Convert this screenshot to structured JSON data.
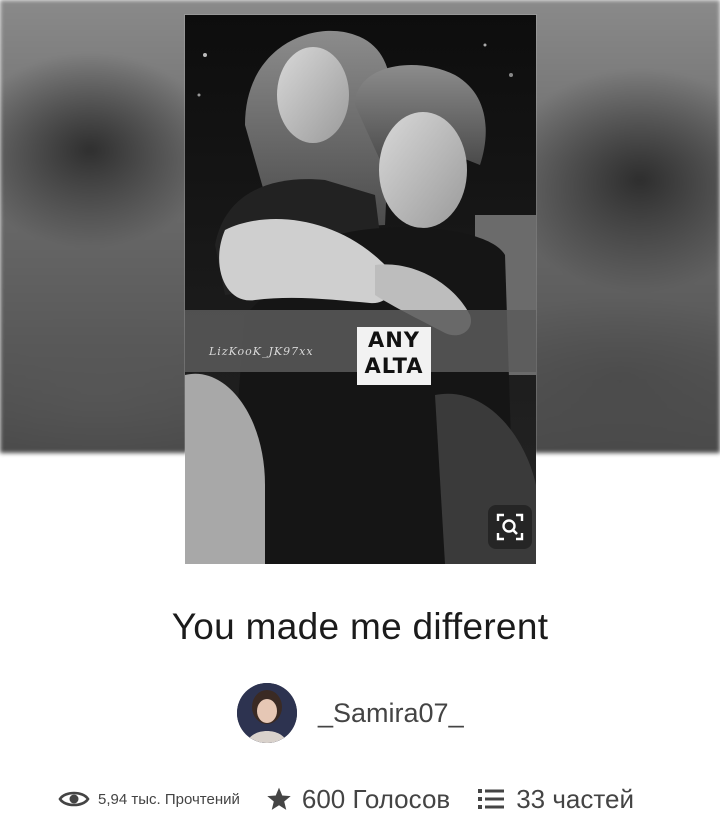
{
  "story": {
    "title": "You made me different",
    "cover": {
      "watermark": "LizKooK_JK97xx",
      "logo_text": "ANY\nALTA"
    },
    "author": {
      "name": "_Samira07_"
    }
  },
  "stats": {
    "reads": "5,94 тыс. Прочтений",
    "votes": "600 Голосов",
    "parts": "33 частей"
  },
  "icons": {
    "reads": "eye-icon",
    "votes": "star-icon",
    "parts": "list-icon",
    "zoom": "zoom-search-icon"
  }
}
